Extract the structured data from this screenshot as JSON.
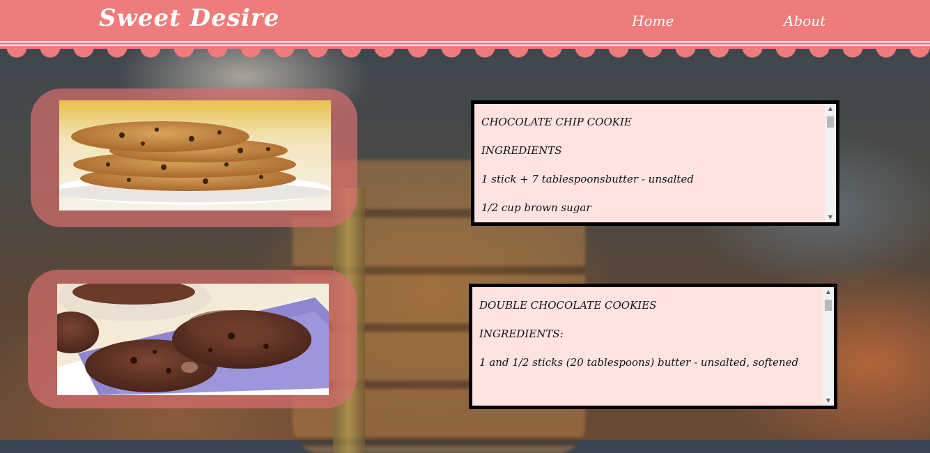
{
  "header": {
    "brand": "Sweet Desire",
    "nav": [
      {
        "label": "Home"
      },
      {
        "label": "About"
      }
    ]
  },
  "recipes": [
    {
      "lines": [
        "CHOCOLATE CHIP COOKIE",
        "INGREDIENTS",
        "1 stick + 7 tablespoonsbutter - unsalted",
        "1/2 cup brown sugar"
      ]
    },
    {
      "lines": [
        "DOUBLE CHOCOLATE COOKIES",
        "INGREDIENTS:",
        "1 and 1/2 sticks (20 tablespoons) butter - unsalted, softened"
      ]
    }
  ],
  "scrollbar": {
    "up_glyph": "▲",
    "down_glyph": "▼"
  },
  "colors": {
    "header": "#ef7b7b",
    "card": "#d66e6e",
    "recipe_bg": "#ffe3e1"
  }
}
